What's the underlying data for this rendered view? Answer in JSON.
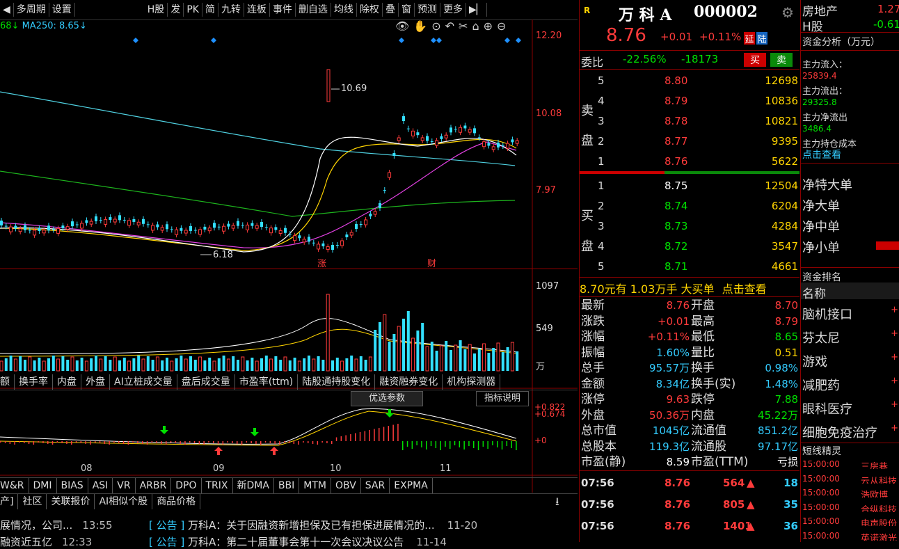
{
  "toolbar": {
    "arrow": "◀",
    "period": "多周期",
    "settings": "设置",
    "items": [
      "H股",
      "发",
      "PK",
      "简",
      "九转",
      "连板",
      "事件",
      "删自选",
      "均线",
      "除权",
      "叠",
      "窗",
      "预测",
      "更多"
    ]
  },
  "ma_line": {
    "left": "68",
    "ma250": "MA250: 8.65"
  },
  "price_axis": [
    "12.20",
    "10.08",
    "7.97"
  ],
  "annot_high": "10.69",
  "annot_low": "6.18",
  "chart_marks": [
    "涨",
    "财"
  ],
  "vol_axis": [
    "1097",
    "549",
    "万"
  ],
  "indicator_tabs": [
    "额",
    "换手率",
    "内盘",
    "外盘",
    "AI立桩成交量",
    "盘后成交量",
    "市盈率(ttm)",
    "陆股通持股变化",
    "融资融券变化",
    "机构探测器"
  ],
  "opt_btn": "优选参数",
  "ind_help": "指标说明",
  "macd_axis": [
    "+0.822",
    "+0.674",
    "+0"
  ],
  "months": [
    "08",
    "09",
    "10",
    "11"
  ],
  "bottom_tabs": [
    "W&R",
    "DMI",
    "BIAS",
    "ASI",
    "VR",
    "ARBR",
    "DPO",
    "TRIX",
    "新DMA",
    "BBI",
    "MTM",
    "OBV",
    "SAR",
    "EXPMA"
  ],
  "news_tabs": [
    "产]",
    "社区",
    "关联报价",
    "AI相似个股",
    "商品价格"
  ],
  "news": [
    {
      "left": "展情况，公司...",
      "time": "13:55",
      "tag": "公告",
      "title": "万科A：关于因融资新增担保及已有担保进展情况的...",
      "date": "11-20"
    },
    {
      "left": "融资近五亿",
      "time": "12:33",
      "tag": "公告",
      "title": "万科A：第二十届董事会第十一次会议决议公告",
      "date": "11-14"
    }
  ],
  "stock": {
    "badge": "R",
    "name": "万 科 A",
    "code": "000002",
    "price": "8.76",
    "change": "+0.01",
    "pct": "+0.11%",
    "tag1": "延",
    "tag2": "陆"
  },
  "weibi": {
    "label": "委比",
    "pct": "-22.56%",
    "diff": "-18173",
    "buy": "买",
    "sell": "卖"
  },
  "sell": [
    {
      "n": "5",
      "p": "8.80",
      "v": "12698"
    },
    {
      "n": "4",
      "p": "8.79",
      "v": "10836"
    },
    {
      "n": "3",
      "p": "8.78",
      "v": "10821"
    },
    {
      "n": "2",
      "p": "8.77",
      "v": "9395"
    },
    {
      "n": "1",
      "p": "8.76",
      "v": "5622"
    }
  ],
  "sell_label": [
    "卖",
    "盘"
  ],
  "buy": [
    {
      "n": "1",
      "p": "8.75",
      "v": "12504"
    },
    {
      "n": "2",
      "p": "8.74",
      "v": "6204"
    },
    {
      "n": "3",
      "p": "8.73",
      "v": "4284"
    },
    {
      "n": "4",
      "p": "8.72",
      "v": "3547"
    },
    {
      "n": "5",
      "p": "8.71",
      "v": "4661"
    }
  ],
  "buy_label": [
    "买",
    "盘"
  ],
  "bigorder": {
    "price": "8.70",
    "unit1": "元有",
    "vol": "1.03",
    "unit2": "万手",
    "label": "大买单",
    "link": "点击查看"
  },
  "stats": [
    [
      "最新",
      "8.76",
      "开盘",
      "8.70"
    ],
    [
      "涨跌",
      "+0.01",
      "最高",
      "8.79"
    ],
    [
      "涨幅",
      "+0.11%",
      "最低",
      "8.65"
    ],
    [
      "振幅",
      "1.60%",
      "量比",
      "0.51"
    ],
    [
      "总手",
      "95.57万",
      "换手",
      "0.98%"
    ],
    [
      "金额",
      "8.34亿",
      "换手(实)",
      "1.48%"
    ],
    [
      "涨停",
      "9.63",
      "跌停",
      "7.88"
    ],
    [
      "外盘",
      "50.36万",
      "内盘",
      "45.22万"
    ],
    [
      "总市值",
      "1045亿",
      "流通值",
      "851.2亿"
    ],
    [
      "总股本",
      "119.3亿",
      "流通股",
      "97.17亿"
    ],
    [
      "市盈(静)",
      "8.59",
      "市盈(TTM)",
      "亏损"
    ]
  ],
  "ticks": [
    {
      "t": "07:56",
      "p": "8.76",
      "v": "564",
      "n": "18"
    },
    {
      "t": "07:56",
      "p": "8.76",
      "v": "805",
      "n": "35"
    },
    {
      "t": "07:56",
      "p": "8.76",
      "v": "1401",
      "n": "36"
    }
  ],
  "side": {
    "sector": "房地产",
    "sector_pct": "1.27",
    "h": "H股",
    "h_pct": "-0.61",
    "fund_title": "资金分析（万元）",
    "fund": [
      [
        "主力流入：",
        "25839.4"
      ],
      [
        "主力流出：",
        "29325.8"
      ],
      [
        "主力净流出",
        "3486.4"
      ],
      [
        "主力持仓成本",
        ""
      ]
    ],
    "fund_link": "点击查看",
    "net": [
      "净特大单",
      "净大单",
      "净中单",
      "净小单"
    ],
    "rank_title": "资金排名",
    "rank_head": "名称",
    "rank": [
      "脑机接口",
      "芬太尼",
      "游戏",
      "减肥药",
      "眼科医疗",
      "细胞免疫治疗"
    ],
    "plus": "+",
    "short_title": "短线精灵",
    "short": [
      [
        "15:00:00",
        "三房巷"
      ],
      [
        "15:00:00",
        "云从科技"
      ],
      [
        "15:00:00",
        "浩欧博"
      ],
      [
        "15:00:00",
        "合纵科技"
      ],
      [
        "15:00:00",
        "电声股份"
      ],
      [
        "15:00:00",
        "英诺激光"
      ]
    ]
  }
}
